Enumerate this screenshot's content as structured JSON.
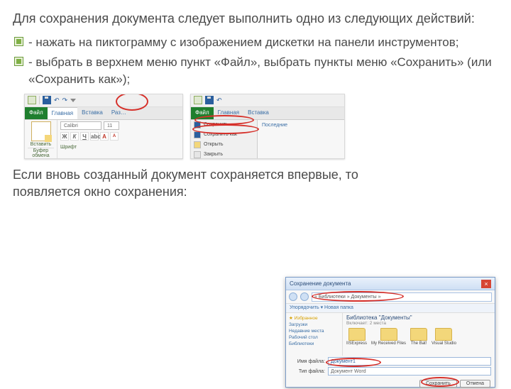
{
  "intro": "Для сохранения документа следует выполнить одно из следующих действий:",
  "bullets": [
    "- нажать на пиктограмму с изображением дискетки на панели инструментов;",
    "- выбрать в верхнем меню пункт «Файл», выбрать пункты меню «Сохранить» (или «Сохранить как»);"
  ],
  "para2": "Если вновь созданный документ сохраняется впервые, то появляется окно сохранения:",
  "ribbon": {
    "tabs": {
      "file": "Файл",
      "home": "Главная",
      "insert": "Вставка",
      "layout": "Раз…"
    },
    "group_paste": "Вставить",
    "clipboard_caption": "Буфер обмена",
    "font_name": "Calibri",
    "font_size": "11",
    "font_caption": "Шрифт",
    "bold": "Ж",
    "italic": "К",
    "underline": "Ч",
    "a_big": "A",
    "a_small": "A"
  },
  "filemenu": {
    "items": [
      "Сохранить",
      "Сохранить как",
      "Открыть",
      "Закрыть"
    ],
    "right_header": "Последние"
  },
  "savedlg": {
    "title": "Сохранение документа",
    "path": "« Библиотеки » Документы »",
    "toolbar": "Упорядочить ▾      Новая папка",
    "side": [
      "★ Избранное",
      "  Загрузки",
      "  Недавние места",
      "  Рабочий стол",
      "",
      "Библиотеки"
    ],
    "lib_title": "Библиотека \"Документы\"",
    "lib_sub": "Включает: 2 места",
    "folders": [
      "IISExpress",
      "My Received Files",
      "The Bat!",
      "Visual Studio"
    ],
    "fname_label": "Имя файла:",
    "fname_value": "Документ1",
    "ftype_label": "Тип файла:",
    "ftype_value": "Документ Word",
    "save_btn": "Сохранить",
    "cancel_btn": "Отмена"
  }
}
